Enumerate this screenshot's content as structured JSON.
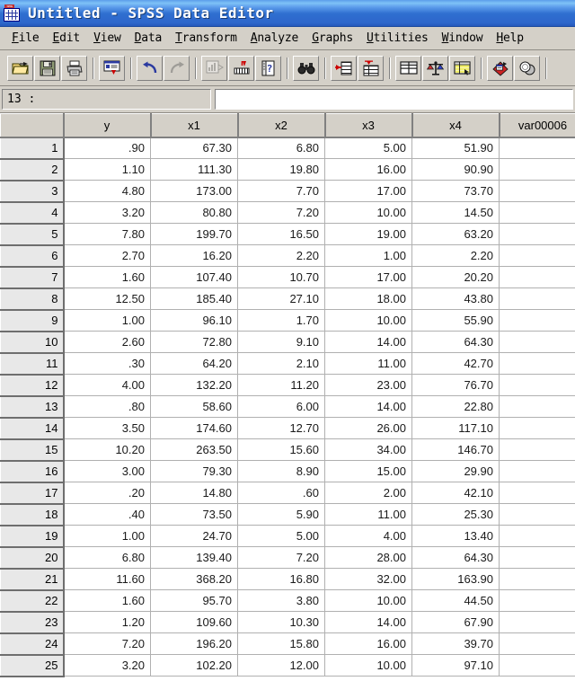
{
  "window": {
    "title": "Untitled - SPSS Data Editor",
    "icon": "spss-data-editor-icon",
    "titlebar_color": "#2f6fd0"
  },
  "menu": {
    "items": [
      {
        "label": "File",
        "mnemonic": "F",
        "rest": "ile"
      },
      {
        "label": "Edit",
        "mnemonic": "E",
        "rest": "dit"
      },
      {
        "label": "View",
        "mnemonic": "V",
        "rest": "iew"
      },
      {
        "label": "Data",
        "mnemonic": "D",
        "rest": "ata"
      },
      {
        "label": "Transform",
        "mnemonic": "T",
        "rest": "ransform"
      },
      {
        "label": "Analyze",
        "mnemonic": "A",
        "rest": "nalyze"
      },
      {
        "label": "Graphs",
        "mnemonic": "G",
        "rest": "raphs"
      },
      {
        "label": "Utilities",
        "mnemonic": "U",
        "rest": "tilities"
      },
      {
        "label": "Window",
        "mnemonic": "W",
        "rest": "indow"
      },
      {
        "label": "Help",
        "mnemonic": "H",
        "rest": "elp"
      }
    ]
  },
  "toolbar": {
    "buttons": [
      {
        "name": "open-file-icon",
        "tooltip": "Open File",
        "enabled": true
      },
      {
        "name": "save-file-icon",
        "tooltip": "Save File",
        "enabled": true
      },
      {
        "name": "print-icon",
        "tooltip": "Print",
        "enabled": true
      },
      {
        "name": "dialog-recall-icon",
        "tooltip": "Dialog Recall",
        "enabled": true
      },
      {
        "name": "undo-icon",
        "tooltip": "Undo",
        "enabled": true
      },
      {
        "name": "redo-icon",
        "tooltip": "Redo",
        "enabled": false
      },
      {
        "name": "goto-chart-icon",
        "tooltip": "Go To Chart",
        "enabled": false
      },
      {
        "name": "goto-case-icon",
        "tooltip": "Go To Case",
        "enabled": true
      },
      {
        "name": "variables-icon",
        "tooltip": "Variables",
        "enabled": true
      },
      {
        "name": "find-icon",
        "tooltip": "Find",
        "enabled": true
      },
      {
        "name": "insert-case-icon",
        "tooltip": "Insert Case",
        "enabled": true
      },
      {
        "name": "insert-variable-icon",
        "tooltip": "Insert Variable",
        "enabled": true
      },
      {
        "name": "split-file-icon",
        "tooltip": "Split File",
        "enabled": true
      },
      {
        "name": "weight-cases-icon",
        "tooltip": "Weight Cases",
        "enabled": true
      },
      {
        "name": "select-cases-icon",
        "tooltip": "Select Cases",
        "enabled": true
      },
      {
        "name": "value-labels-icon",
        "tooltip": "Value Labels",
        "enabled": true
      },
      {
        "name": "use-sets-icon",
        "tooltip": "Use Sets",
        "enabled": true
      }
    ]
  },
  "cell_bar": {
    "reference": "13 :",
    "value": ""
  },
  "grid": {
    "row_header_label": "",
    "columns": [
      "y",
      "x1",
      "x2",
      "x3",
      "x4",
      "var00006"
    ],
    "rows": [
      {
        "n": "1",
        "values": [
          ".90",
          "67.30",
          "6.80",
          "5.00",
          "51.90",
          "."
        ]
      },
      {
        "n": "2",
        "values": [
          "1.10",
          "111.30",
          "19.80",
          "16.00",
          "90.90",
          "."
        ]
      },
      {
        "n": "3",
        "values": [
          "4.80",
          "173.00",
          "7.70",
          "17.00",
          "73.70",
          "."
        ]
      },
      {
        "n": "4",
        "values": [
          "3.20",
          "80.80",
          "7.20",
          "10.00",
          "14.50",
          "."
        ]
      },
      {
        "n": "5",
        "values": [
          "7.80",
          "199.70",
          "16.50",
          "19.00",
          "63.20",
          "."
        ]
      },
      {
        "n": "6",
        "values": [
          "2.70",
          "16.20",
          "2.20",
          "1.00",
          "2.20",
          "."
        ]
      },
      {
        "n": "7",
        "values": [
          "1.60",
          "107.40",
          "10.70",
          "17.00",
          "20.20",
          "."
        ]
      },
      {
        "n": "8",
        "values": [
          "12.50",
          "185.40",
          "27.10",
          "18.00",
          "43.80",
          "."
        ]
      },
      {
        "n": "9",
        "values": [
          "1.00",
          "96.10",
          "1.70",
          "10.00",
          "55.90",
          "."
        ]
      },
      {
        "n": "10",
        "values": [
          "2.60",
          "72.80",
          "9.10",
          "14.00",
          "64.30",
          "."
        ]
      },
      {
        "n": "11",
        "values": [
          ".30",
          "64.20",
          "2.10",
          "11.00",
          "42.70",
          "."
        ]
      },
      {
        "n": "12",
        "values": [
          "4.00",
          "132.20",
          "11.20",
          "23.00",
          "76.70",
          "."
        ]
      },
      {
        "n": "13",
        "values": [
          ".80",
          "58.60",
          "6.00",
          "14.00",
          "22.80",
          "."
        ]
      },
      {
        "n": "14",
        "values": [
          "3.50",
          "174.60",
          "12.70",
          "26.00",
          "117.10",
          "."
        ]
      },
      {
        "n": "15",
        "values": [
          "10.20",
          "263.50",
          "15.60",
          "34.00",
          "146.70",
          "."
        ]
      },
      {
        "n": "16",
        "values": [
          "3.00",
          "79.30",
          "8.90",
          "15.00",
          "29.90",
          "."
        ]
      },
      {
        "n": "17",
        "values": [
          ".20",
          "14.80",
          ".60",
          "2.00",
          "42.10",
          "."
        ]
      },
      {
        "n": "18",
        "values": [
          ".40",
          "73.50",
          "5.90",
          "11.00",
          "25.30",
          "."
        ]
      },
      {
        "n": "19",
        "values": [
          "1.00",
          "24.70",
          "5.00",
          "4.00",
          "13.40",
          "."
        ]
      },
      {
        "n": "20",
        "values": [
          "6.80",
          "139.40",
          "7.20",
          "28.00",
          "64.30",
          "."
        ]
      },
      {
        "n": "21",
        "values": [
          "11.60",
          "368.20",
          "16.80",
          "32.00",
          "163.90",
          "."
        ]
      },
      {
        "n": "22",
        "values": [
          "1.60",
          "95.70",
          "3.80",
          "10.00",
          "44.50",
          "."
        ]
      },
      {
        "n": "23",
        "values": [
          "1.20",
          "109.60",
          "10.30",
          "14.00",
          "67.90",
          "."
        ]
      },
      {
        "n": "24",
        "values": [
          "7.20",
          "196.20",
          "15.80",
          "16.00",
          "39.70",
          "."
        ]
      },
      {
        "n": "25",
        "values": [
          "3.20",
          "102.20",
          "12.00",
          "10.00",
          "97.10",
          "."
        ]
      }
    ]
  }
}
